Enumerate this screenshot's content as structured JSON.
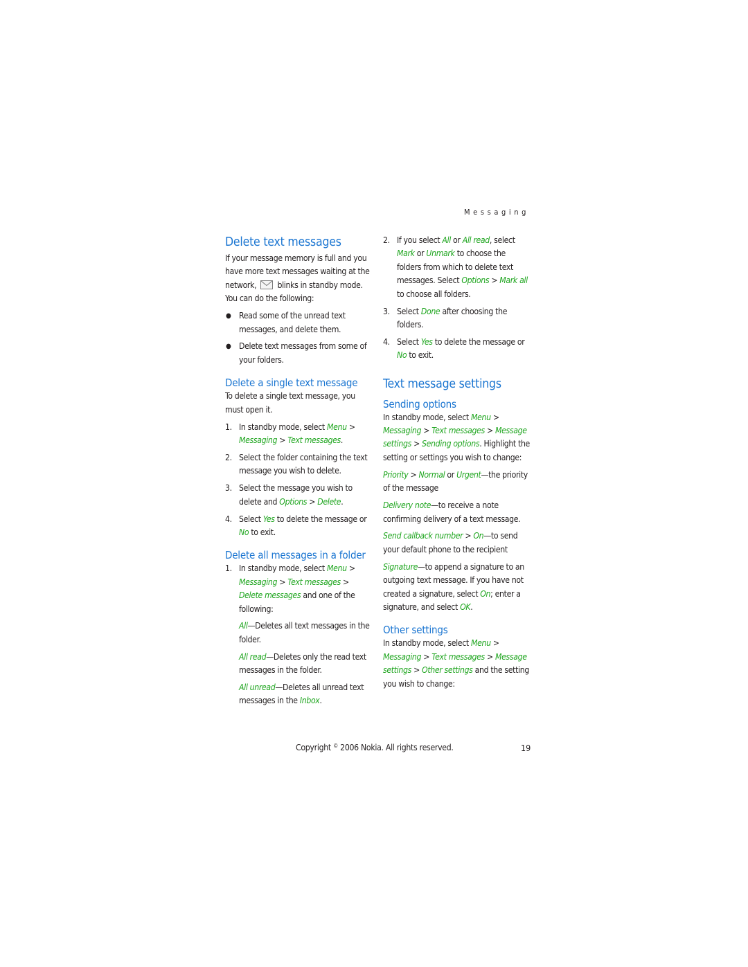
{
  "running_head": "Messaging",
  "colors": {
    "heading": "#1a75d1",
    "menu_term": "#1ea51e",
    "text": "#231f20"
  },
  "left_column": {
    "title": "Delete text messages",
    "intro_before_icon": "If your message memory is full and you have more text messages waiting at the network, ",
    "intro_icon": "envelope-icon",
    "intro_after_icon": " blinks in standby mode. You can do the following:",
    "bullets": [
      "Read some of the unread text messages, and delete them.",
      "Delete text messages from some of your folders."
    ],
    "single": {
      "title": "Delete a single text message",
      "intro": "To delete a single text message, you must open it.",
      "steps": [
        {
          "num": "1.",
          "t1": "In standby mode, select ",
          "m1": "Menu",
          "t2": " > ",
          "m2": "Messaging",
          "t3": " > ",
          "m3": "Text messages",
          "t4": "."
        },
        {
          "num": "2.",
          "text": "Select the folder containing the text message you wish to delete."
        },
        {
          "num": "3.",
          "t1": "Select the message you wish to delete and ",
          "m1": "Options",
          "t2": " > ",
          "m2": "Delete",
          "t3": "."
        },
        {
          "num": "4.",
          "t1": "Select ",
          "m1": "Yes",
          "t2": " to delete the message or ",
          "m2": "No",
          "t3": " to exit."
        }
      ]
    },
    "folder": {
      "title": "Delete all messages in a folder",
      "step1": {
        "num": "1.",
        "t1": "In standby mode, select ",
        "m1": "Menu",
        "t2": " > ",
        "m2": "Messaging",
        "t3": " > ",
        "m3": "Text messages",
        "t4": " > ",
        "m4": "Delete messages",
        "t5": " and one of the following:"
      },
      "options": [
        {
          "term": "All",
          "desc": "—Deletes all text messages in the folder."
        },
        {
          "term": "All read",
          "desc": "—Deletes only the read text messages in the folder."
        },
        {
          "term": "All unread",
          "desc": "—Deletes all unread text messages in the ",
          "term2": "Inbox",
          "end": "."
        }
      ]
    }
  },
  "right_column": {
    "steps": [
      {
        "num": "2.",
        "t1": "If you select ",
        "m1": "All",
        "t2": " or ",
        "m2": "All read",
        "t3": ", select ",
        "m3": "Mark",
        "t4": " or ",
        "m4": "Unmark",
        "t5": " to choose the folders from which to delete text messages. Select ",
        "m5": "Options",
        "t6": " > ",
        "m6": "Mark all",
        "t7": " to choose all folders."
      },
      {
        "num": "3.",
        "t1": "Select ",
        "m1": "Done",
        "t2": " after choosing the folders."
      },
      {
        "num": "4.",
        "t1": "Select ",
        "m1": "Yes",
        "t2": " to delete the message or ",
        "m2": "No",
        "t3": " to exit."
      }
    ],
    "settings_title": "Text message settings",
    "sending": {
      "title": "Sending options",
      "intro": {
        "t1": "In standby mode, select ",
        "m1": "Menu",
        "t2": " > ",
        "m2": "Messaging",
        "t3": " > ",
        "m3": "Text messages",
        "t4": " > ",
        "m4": "Message settings",
        "t5": " > ",
        "m5": "Sending options",
        "t6": ". Highlight the setting or settings you wish to change:"
      },
      "items": [
        {
          "m1": "Priority",
          "t1": " > ",
          "m2": "Normal",
          "t2": " or ",
          "m3": "Urgent",
          "t3": "—the priority of the message"
        },
        {
          "m1": "Delivery note",
          "t1": "—to receive a note confirming delivery of a text message."
        },
        {
          "m1": "Send callback number",
          "t1": " > ",
          "m2": "On",
          "t2": "—to send your default phone to the recipient"
        },
        {
          "m1": "Signature",
          "t1": "—to append a signature to an outgoing text message. If you have not created a signature, select ",
          "m2": "On",
          "t2": "; enter a signature, and select ",
          "m3": "OK",
          "t3": "."
        }
      ]
    },
    "other": {
      "title": "Other settings",
      "intro": {
        "t1": "In standby mode, select ",
        "m1": "Menu",
        "t2": " > ",
        "m2": "Messaging",
        "t3": " > ",
        "m3": "Text messages",
        "t4": " > ",
        "m4": "Message settings",
        "t5": " > ",
        "m5": "Other settings",
        "t6": " and the setting you wish to change:"
      }
    }
  },
  "footer": {
    "copyright_pre": "Copyright ",
    "copyright_symbol": "©",
    "copyright_post": " 2006 Nokia. All rights reserved.",
    "page_number": "19"
  }
}
